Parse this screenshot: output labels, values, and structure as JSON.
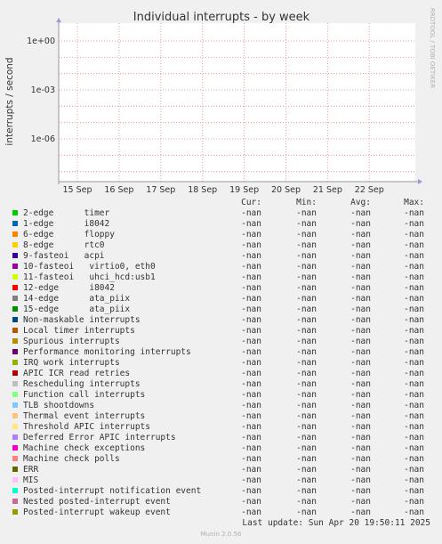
{
  "chart_data": {
    "type": "line",
    "title": "Individual interrupts - by week",
    "ylabel": "interrupts / second",
    "xlabel": "",
    "yscale": "log",
    "ylim": [
      1e-08,
      1
    ],
    "y_ticks": [
      {
        "value": 1,
        "label": "1e+00"
      },
      {
        "value": 0.001,
        "label": "1e-03"
      },
      {
        "value": 1e-06,
        "label": "1e-06"
      }
    ],
    "x_ticks": [
      "15 Sep",
      "16 Sep",
      "17 Sep",
      "18 Sep",
      "19 Sep",
      "20 Sep",
      "21 Sep",
      "22 Sep"
    ],
    "grid": true,
    "side_text": "RRDTOOL / TOBI OETIKER",
    "columns": [
      "Cur:",
      "Min:",
      "Avg:",
      "Max:"
    ],
    "series": [
      {
        "name": "2-edge      timer",
        "color": "#00cc00",
        "cur": "-nan",
        "min": "-nan",
        "avg": "-nan",
        "max": "-nan"
      },
      {
        "name": "1-edge      i8042",
        "color": "#0066b3",
        "cur": "-nan",
        "min": "-nan",
        "avg": "-nan",
        "max": "-nan"
      },
      {
        "name": "6-edge      floppy",
        "color": "#ff8000",
        "cur": "-nan",
        "min": "-nan",
        "avg": "-nan",
        "max": "-nan"
      },
      {
        "name": "8-edge      rtc0",
        "color": "#ffcc00",
        "cur": "-nan",
        "min": "-nan",
        "avg": "-nan",
        "max": "-nan"
      },
      {
        "name": "9-fasteoi   acpi",
        "color": "#330099",
        "cur": "-nan",
        "min": "-nan",
        "avg": "-nan",
        "max": "-nan"
      },
      {
        "name": "10-fasteoi   virtio0, eth0",
        "color": "#990099",
        "cur": "-nan",
        "min": "-nan",
        "avg": "-nan",
        "max": "-nan"
      },
      {
        "name": "11-fasteoi   uhci_hcd:usb1",
        "color": "#ccff00",
        "cur": "-nan",
        "min": "-nan",
        "avg": "-nan",
        "max": "-nan"
      },
      {
        "name": "12-edge      i8042",
        "color": "#ff0000",
        "cur": "-nan",
        "min": "-nan",
        "avg": "-nan",
        "max": "-nan"
      },
      {
        "name": "14-edge      ata_piix",
        "color": "#808080",
        "cur": "-nan",
        "min": "-nan",
        "avg": "-nan",
        "max": "-nan"
      },
      {
        "name": "15-edge      ata_piix",
        "color": "#008f00",
        "cur": "-nan",
        "min": "-nan",
        "avg": "-nan",
        "max": "-nan"
      },
      {
        "name": "Non-maskable interrupts",
        "color": "#00487d",
        "cur": "-nan",
        "min": "-nan",
        "avg": "-nan",
        "max": "-nan"
      },
      {
        "name": "Local timer interrupts",
        "color": "#b35a00",
        "cur": "-nan",
        "min": "-nan",
        "avg": "-nan",
        "max": "-nan"
      },
      {
        "name": "Spurious interrupts",
        "color": "#b38f00",
        "cur": "-nan",
        "min": "-nan",
        "avg": "-nan",
        "max": "-nan"
      },
      {
        "name": "Performance monitoring interrupts",
        "color": "#6b006b",
        "cur": "-nan",
        "min": "-nan",
        "avg": "-nan",
        "max": "-nan"
      },
      {
        "name": "IRQ work interrupts",
        "color": "#8fb300",
        "cur": "-nan",
        "min": "-nan",
        "avg": "-nan",
        "max": "-nan"
      },
      {
        "name": "APIC ICR read retries",
        "color": "#b30000",
        "cur": "-nan",
        "min": "-nan",
        "avg": "-nan",
        "max": "-nan"
      },
      {
        "name": "Rescheduling interrupts",
        "color": "#bebebe",
        "cur": "-nan",
        "min": "-nan",
        "avg": "-nan",
        "max": "-nan"
      },
      {
        "name": "Function call interrupts",
        "color": "#80ff80",
        "cur": "-nan",
        "min": "-nan",
        "avg": "-nan",
        "max": "-nan"
      },
      {
        "name": "TLB shootdowns",
        "color": "#80c9ff",
        "cur": "-nan",
        "min": "-nan",
        "avg": "-nan",
        "max": "-nan"
      },
      {
        "name": "Thermal event interrupts",
        "color": "#ffc080",
        "cur": "-nan",
        "min": "-nan",
        "avg": "-nan",
        "max": "-nan"
      },
      {
        "name": "Threshold APIC interrupts",
        "color": "#ffe680",
        "cur": "-nan",
        "min": "-nan",
        "avg": "-nan",
        "max": "-nan"
      },
      {
        "name": "Deferred Error APIC interrupts",
        "color": "#aa80ff",
        "cur": "-nan",
        "min": "-nan",
        "avg": "-nan",
        "max": "-nan"
      },
      {
        "name": "Machine check exceptions",
        "color": "#ee00cc",
        "cur": "-nan",
        "min": "-nan",
        "avg": "-nan",
        "max": "-nan"
      },
      {
        "name": "Machine check polls",
        "color": "#ff8080",
        "cur": "-nan",
        "min": "-nan",
        "avg": "-nan",
        "max": "-nan"
      },
      {
        "name": "ERR",
        "color": "#666600",
        "cur": "-nan",
        "min": "-nan",
        "avg": "-nan",
        "max": "-nan"
      },
      {
        "name": "MIS",
        "color": "#ffbfff",
        "cur": "-nan",
        "min": "-nan",
        "avg": "-nan",
        "max": "-nan"
      },
      {
        "name": "Posted-interrupt notification event",
        "color": "#00ffcc",
        "cur": "-nan",
        "min": "-nan",
        "avg": "-nan",
        "max": "-nan"
      },
      {
        "name": "Nested posted-interrupt event",
        "color": "#cc6699",
        "cur": "-nan",
        "min": "-nan",
        "avg": "-nan",
        "max": "-nan"
      },
      {
        "name": "Posted-interrupt wakeup event",
        "color": "#999900",
        "cur": "-nan",
        "min": "-nan",
        "avg": "-nan",
        "max": "-nan"
      }
    ]
  },
  "footer": {
    "last_update": "Last update: Sun Apr 20 19:50:11 2025",
    "version": "Munin 2.0.56"
  }
}
